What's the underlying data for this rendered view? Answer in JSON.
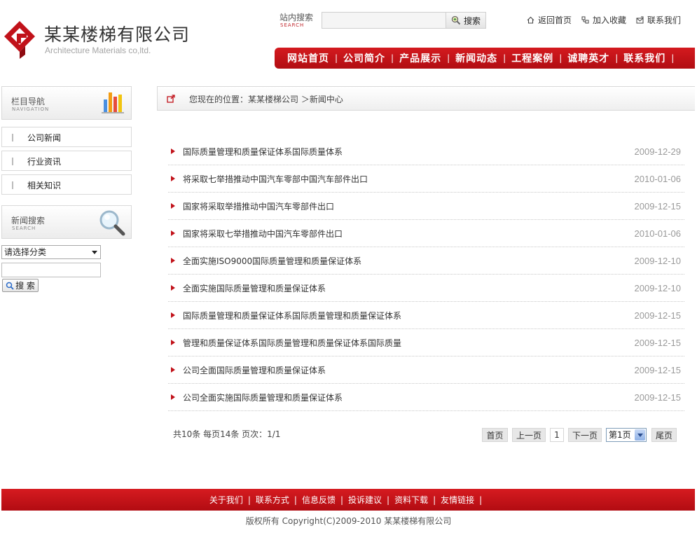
{
  "brand": {
    "name": "某某楼梯有限公司",
    "english": "Architecture Materials co,ltd.",
    "color": "#c1121a"
  },
  "top_search": {
    "label": "站内搜索",
    "label_en": "SEARCH",
    "value": "",
    "button": "搜索",
    "icon": "magnifier-icon"
  },
  "quick_links": [
    {
      "label": "返回首页",
      "icon": "home-icon"
    },
    {
      "label": "加入收藏",
      "icon": "bookmark-icon"
    },
    {
      "label": "联系我们",
      "icon": "mail-icon"
    }
  ],
  "nav": {
    "items": [
      "网站首页",
      "公司简介",
      "产品展示",
      "新闻动态",
      "工程案例",
      "诚聘英才",
      "联系我们"
    ],
    "separator": "|"
  },
  "sidebar": {
    "nav_title": "栏目导航",
    "nav_sub": "NAVIGATION",
    "nav_icon": "bar-chart-icon",
    "items": [
      "公司新闻",
      "行业资讯",
      "相关知识"
    ],
    "search_title": "新闻搜索",
    "search_sub": "SEARCH",
    "search_icon": "magnifier-icon",
    "category_selected": "请选择分类",
    "keyword_value": "",
    "search_button": "搜 索"
  },
  "breadcrumb": {
    "text": "您现在的位置：某某楼梯公司 ＞新闻中心",
    "icon": "external-link-icon"
  },
  "news": [
    {
      "title": "国际质量管理和质量保证体系国际质量体系",
      "date": "2009-12-29"
    },
    {
      "title": "将采取七举措推动中国汽车零部中国汽车部件出口",
      "date": "2010-01-06"
    },
    {
      "title": "国家将采取举措推动中国汽车零部件出口",
      "date": "2009-12-15"
    },
    {
      "title": "国家将采取七举措推动中国汽车零部件出口",
      "date": "2010-01-06"
    },
    {
      "title": "全面实施ISO9000国际质量管理和质量保证体系",
      "date": "2009-12-10"
    },
    {
      "title": "全面实施国际质量管理和质量保证体系",
      "date": "2009-12-10"
    },
    {
      "title": "国际质量管理和质量保证体系国际质量管理和质量保证体系",
      "date": "2009-12-15"
    },
    {
      "title": "管理和质量保证体系国际质量管理和质量保证体系国际质量",
      "date": "2009-12-15"
    },
    {
      "title": "公司全面国际质量管理和质量保证体系",
      "date": "2009-12-15"
    },
    {
      "title": "公司全面实施国际质量管理和质量保证体系",
      "date": "2009-12-15"
    }
  ],
  "pager": {
    "info": "共10条  每页14条  页次：1/1",
    "first": "首页",
    "prev": "上一页",
    "current": "1",
    "next": "下一页",
    "page_select": "第1页",
    "last": "尾页"
  },
  "footer": {
    "links": [
      "关于我们",
      "联系方式",
      "信息反馈",
      "投诉建议",
      "资料下载",
      "友情链接"
    ],
    "separator": "|",
    "copyright": "版权所有  Copyright(C)2009-2010 某某楼梯有限公司"
  }
}
